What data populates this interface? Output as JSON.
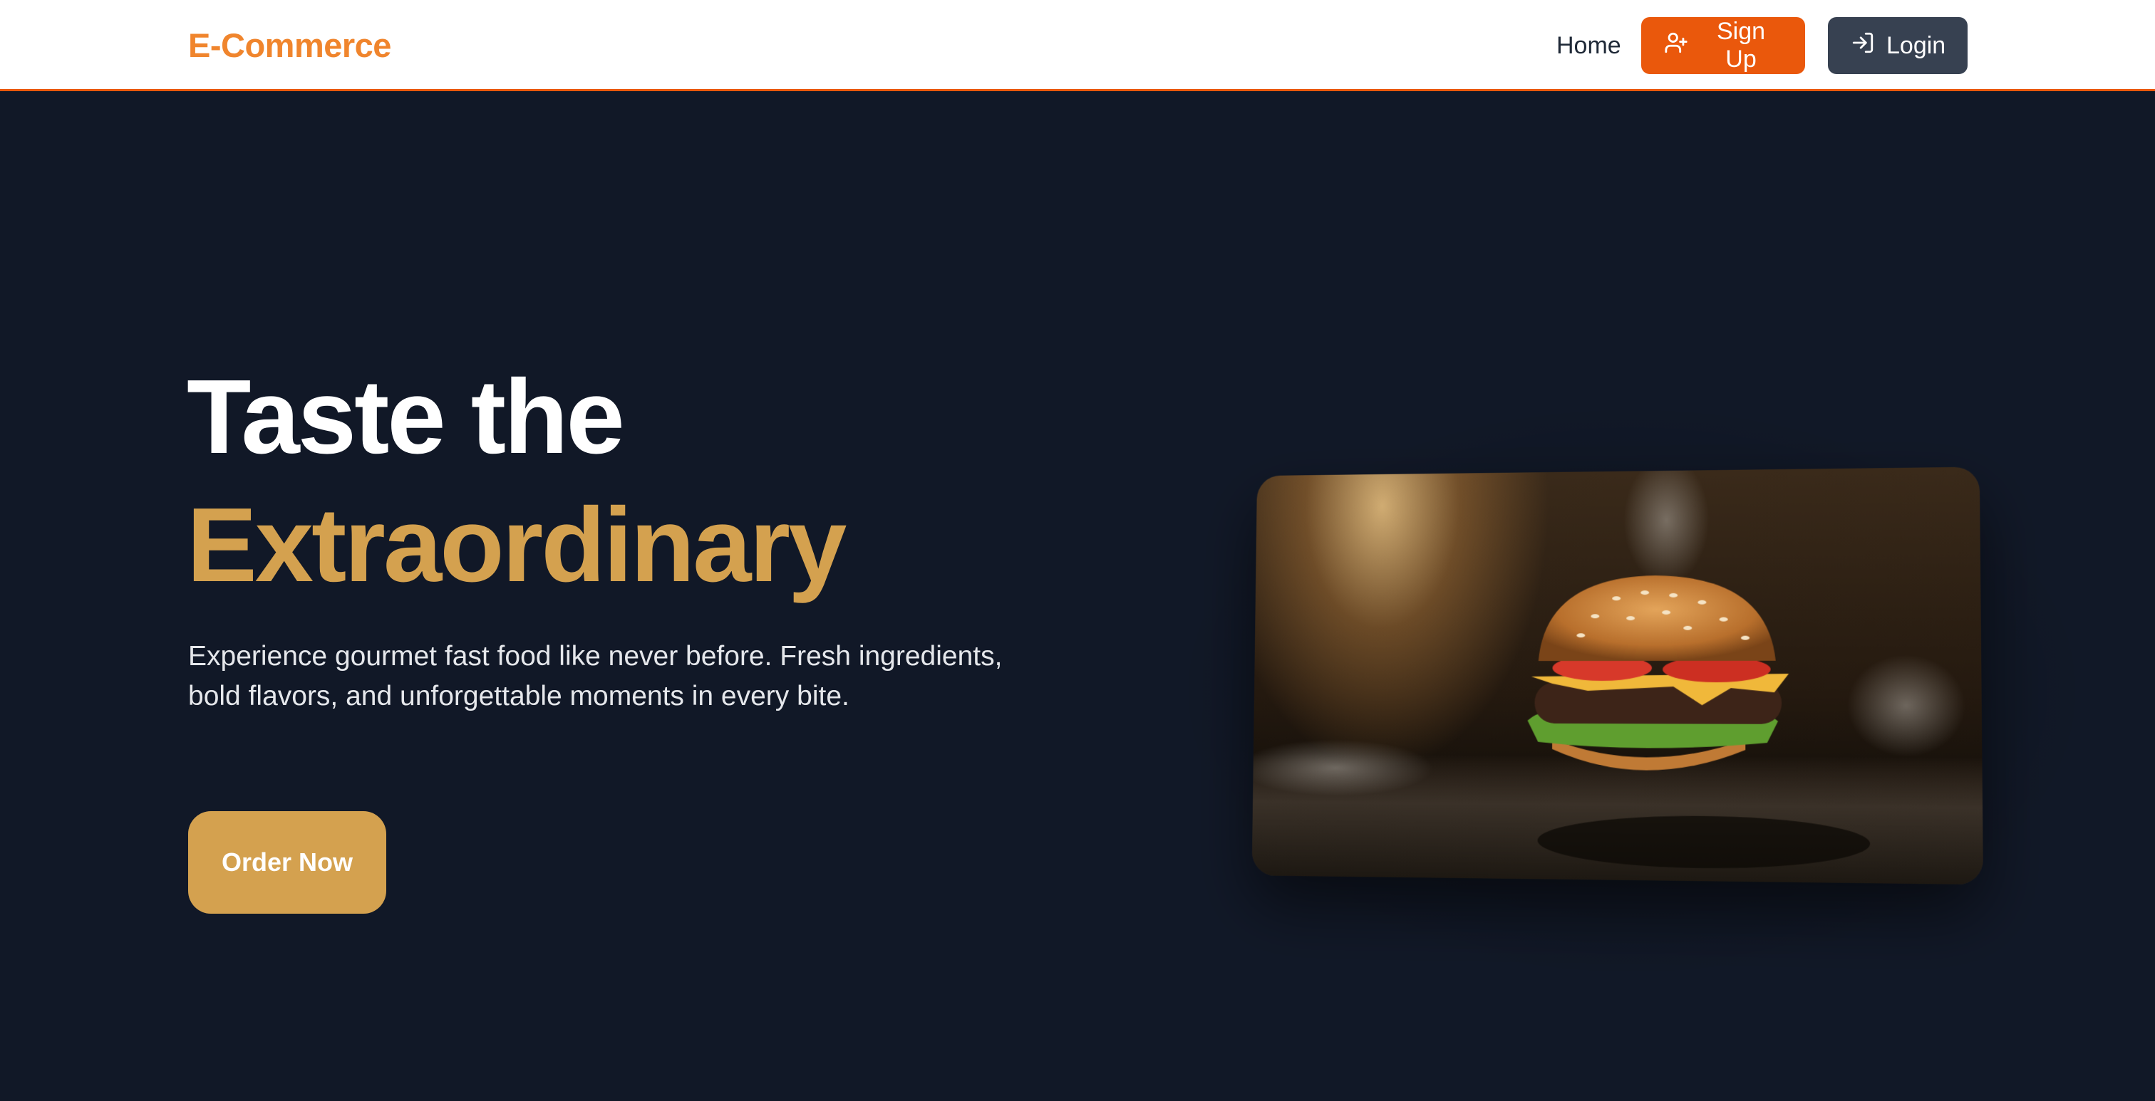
{
  "header": {
    "brand": "E-Commerce",
    "nav_home": "Home",
    "signup_label": "Sign Up",
    "login_label": "Login"
  },
  "hero": {
    "headline_line1": "Taste the",
    "headline_line2": "Extraordinary",
    "tagline": "Experience gourmet fast food like never before. Fresh ingredients, bold flavors, and unforgettable moments in every bite.",
    "cta_label": "Order Now"
  },
  "colors": {
    "brand": "#f0852d",
    "signup_bg": "#ea580c",
    "login_bg": "#374151",
    "accent_gold": "#d4a14f",
    "hero_bg": "#111827"
  },
  "icons": {
    "signup": "user-plus-icon",
    "login": "log-in-icon"
  }
}
